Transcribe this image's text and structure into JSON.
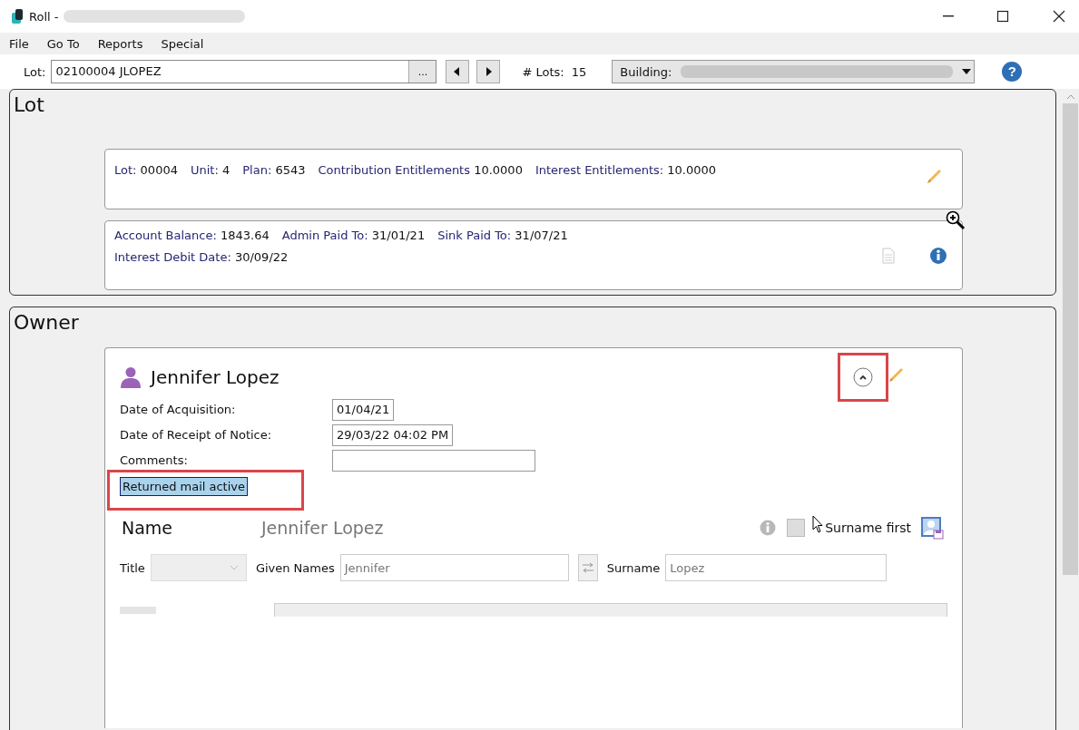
{
  "window": {
    "title": "Roll -"
  },
  "menu": [
    {
      "label": "File"
    },
    {
      "label": "Go To"
    },
    {
      "label": "Reports"
    },
    {
      "label": "Special"
    }
  ],
  "toolbar": {
    "lot_label": "Lot:",
    "lot_value": "02100004 JLOPEZ",
    "browse": "...",
    "lots_label": "# Lots:",
    "lots_count": "15",
    "building_label": "Building:",
    "help": "?"
  },
  "lot_section": {
    "heading": "Lot",
    "summary": [
      {
        "label": "Lot:",
        "value": "00004"
      },
      {
        "label": "Unit:",
        "value": "4"
      },
      {
        "label": "Plan:",
        "value": "6543"
      },
      {
        "label": "Contribution Entitlements",
        "value": "10.0000"
      },
      {
        "label": "Interest Entitlements:",
        "value": "10.0000"
      }
    ],
    "balance_lines": [
      [
        {
          "label": "Account Balance:",
          "value": "1843.64"
        },
        {
          "label": "Admin Paid To:",
          "value": "31/01/21"
        },
        {
          "label": "Sink Paid To:",
          "value": "31/07/21"
        }
      ],
      [
        {
          "label": "Interest Debit Date:",
          "value": "30/09/22"
        }
      ]
    ]
  },
  "owner_section": {
    "heading": "Owner",
    "owner_name": "Jennifer Lopez",
    "expanded": true,
    "details": [
      {
        "label": "Date of Acquisition:",
        "value": "01/04/21"
      },
      {
        "label": "Date of Receipt of Notice:",
        "value": "29/03/22 04:02 PM"
      },
      {
        "label": "Comments:"
      }
    ],
    "returned_mail": {
      "label": "Returned mail active",
      "selected": true
    },
    "name_row": {
      "label": "Name",
      "display": "Jennifer Lopez",
      "surname_first": {
        "label": "Surname first",
        "checked": false
      }
    },
    "name_fields": {
      "title_label": "Title",
      "given_label": "Given Names",
      "given_value": "Jennifer",
      "surname_label": "Surname",
      "surname_value": "Lopez"
    }
  }
}
